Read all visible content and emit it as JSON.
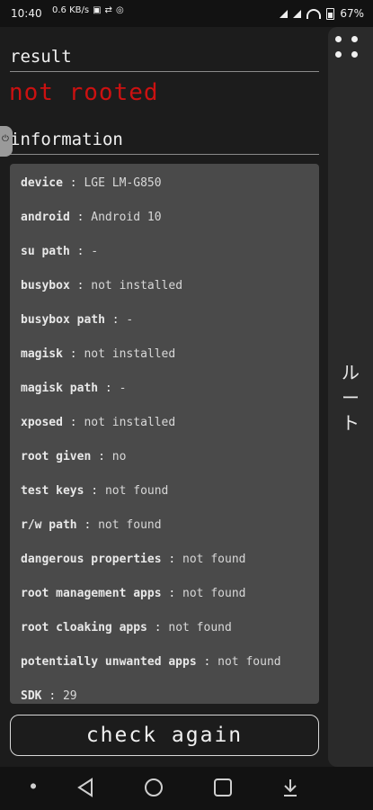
{
  "status_bar": {
    "time": "10:40",
    "left_icons": [
      "0.6 KB/s",
      "sim-icon",
      "usb-icon",
      "vpn-icon"
    ],
    "battery": "67%"
  },
  "result": {
    "heading": "result",
    "value": "not rooted",
    "value_color": "#cc1111"
  },
  "information": {
    "heading": "information",
    "rows": [
      {
        "key": "device",
        "value": "LGE LM-G850"
      },
      {
        "key": "android",
        "value": "Android 10"
      },
      {
        "key": "su path",
        "value": "-"
      },
      {
        "key": "busybox",
        "value": "not installed"
      },
      {
        "key": "busybox path",
        "value": "-"
      },
      {
        "key": "magisk",
        "value": "not installed"
      },
      {
        "key": "magisk path",
        "value": "-"
      },
      {
        "key": "xposed",
        "value": "not installed"
      },
      {
        "key": "root given",
        "value": "no"
      },
      {
        "key": "test keys",
        "value": "not found"
      },
      {
        "key": "r/w path",
        "value": "not found"
      },
      {
        "key": "dangerous properties",
        "value": "not found"
      },
      {
        "key": "root management apps",
        "value": "not found"
      },
      {
        "key": "root cloaking apps",
        "value": "not found"
      },
      {
        "key": "potentially unwanted apps",
        "value": "not found"
      },
      {
        "key": "SDK",
        "value": "29"
      }
    ]
  },
  "check_button": {
    "label": "check again"
  },
  "side_panel": {
    "vertical_text": "ルート"
  },
  "nav_bar": {
    "icons": [
      "dot-icon",
      "back-icon",
      "home-icon",
      "recents-icon",
      "download-icon"
    ]
  }
}
